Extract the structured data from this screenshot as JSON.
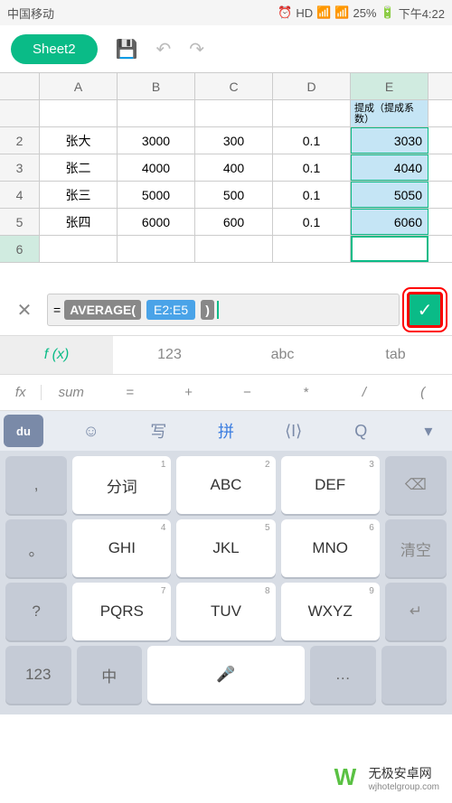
{
  "status": {
    "carrier": "中国移动",
    "battery": "25%",
    "time": "下午4:22"
  },
  "toolbar": {
    "sheet": "Sheet2"
  },
  "sheet": {
    "columns": [
      "A",
      "B",
      "C",
      "D",
      "E"
    ],
    "header_e": "提成（提成系数）",
    "rows": [
      {
        "n": "2",
        "A": "张大",
        "B": "3000",
        "C": "300",
        "D": "0.1",
        "E": "3030"
      },
      {
        "n": "3",
        "A": "张二",
        "B": "4000",
        "C": "400",
        "D": "0.1",
        "E": "4040"
      },
      {
        "n": "4",
        "A": "张三",
        "B": "5000",
        "C": "500",
        "D": "0.1",
        "E": "5050"
      },
      {
        "n": "5",
        "A": "张四",
        "B": "6000",
        "C": "600",
        "D": "0.1",
        "E": "6060"
      }
    ],
    "active_row": "6"
  },
  "formula": {
    "eq": "=",
    "func": "AVERAGE(",
    "range": "E2:E5",
    "close": ")"
  },
  "modes": {
    "fx": "f (x)",
    "num": "123",
    "abc": "abc",
    "tab": "tab"
  },
  "fxrow": {
    "fx": "fx",
    "sum": "sum",
    "eq": "=",
    "plus": "+",
    "minus": "−",
    "mult": "*",
    "div": "/",
    "paren": "("
  },
  "ime": {
    "logo": "du",
    "smile": "☺",
    "hand": "写",
    "pin": "拼",
    "code": "⟨I⟩",
    "search": "Q",
    "down": "▾"
  },
  "keys": {
    "r1": {
      "comma": ",",
      "k1": "分词",
      "s1": "1",
      "k2": "ABC",
      "s2": "2",
      "k3": "DEF",
      "s3": "3",
      "del": "⌫"
    },
    "r2": {
      "period": "。",
      "k4": "GHI",
      "s4": "4",
      "k5": "JKL",
      "s5": "5",
      "k6": "MNO",
      "s6": "6",
      "clear": "清空"
    },
    "r3": {
      "q": "?",
      "k7": "PQRS",
      "s7": "7",
      "k8": "TUV",
      "s8": "8",
      "k9": "WXYZ",
      "s9": "9",
      "enter": "↵"
    },
    "r4": {
      "num": "123",
      "zh": "中",
      "sp": "",
      "mic": "🎤",
      "more": "…",
      "ent": ""
    }
  },
  "watermark": {
    "brand": "无极安卓网",
    "url": "wjhotelgroup.com"
  }
}
